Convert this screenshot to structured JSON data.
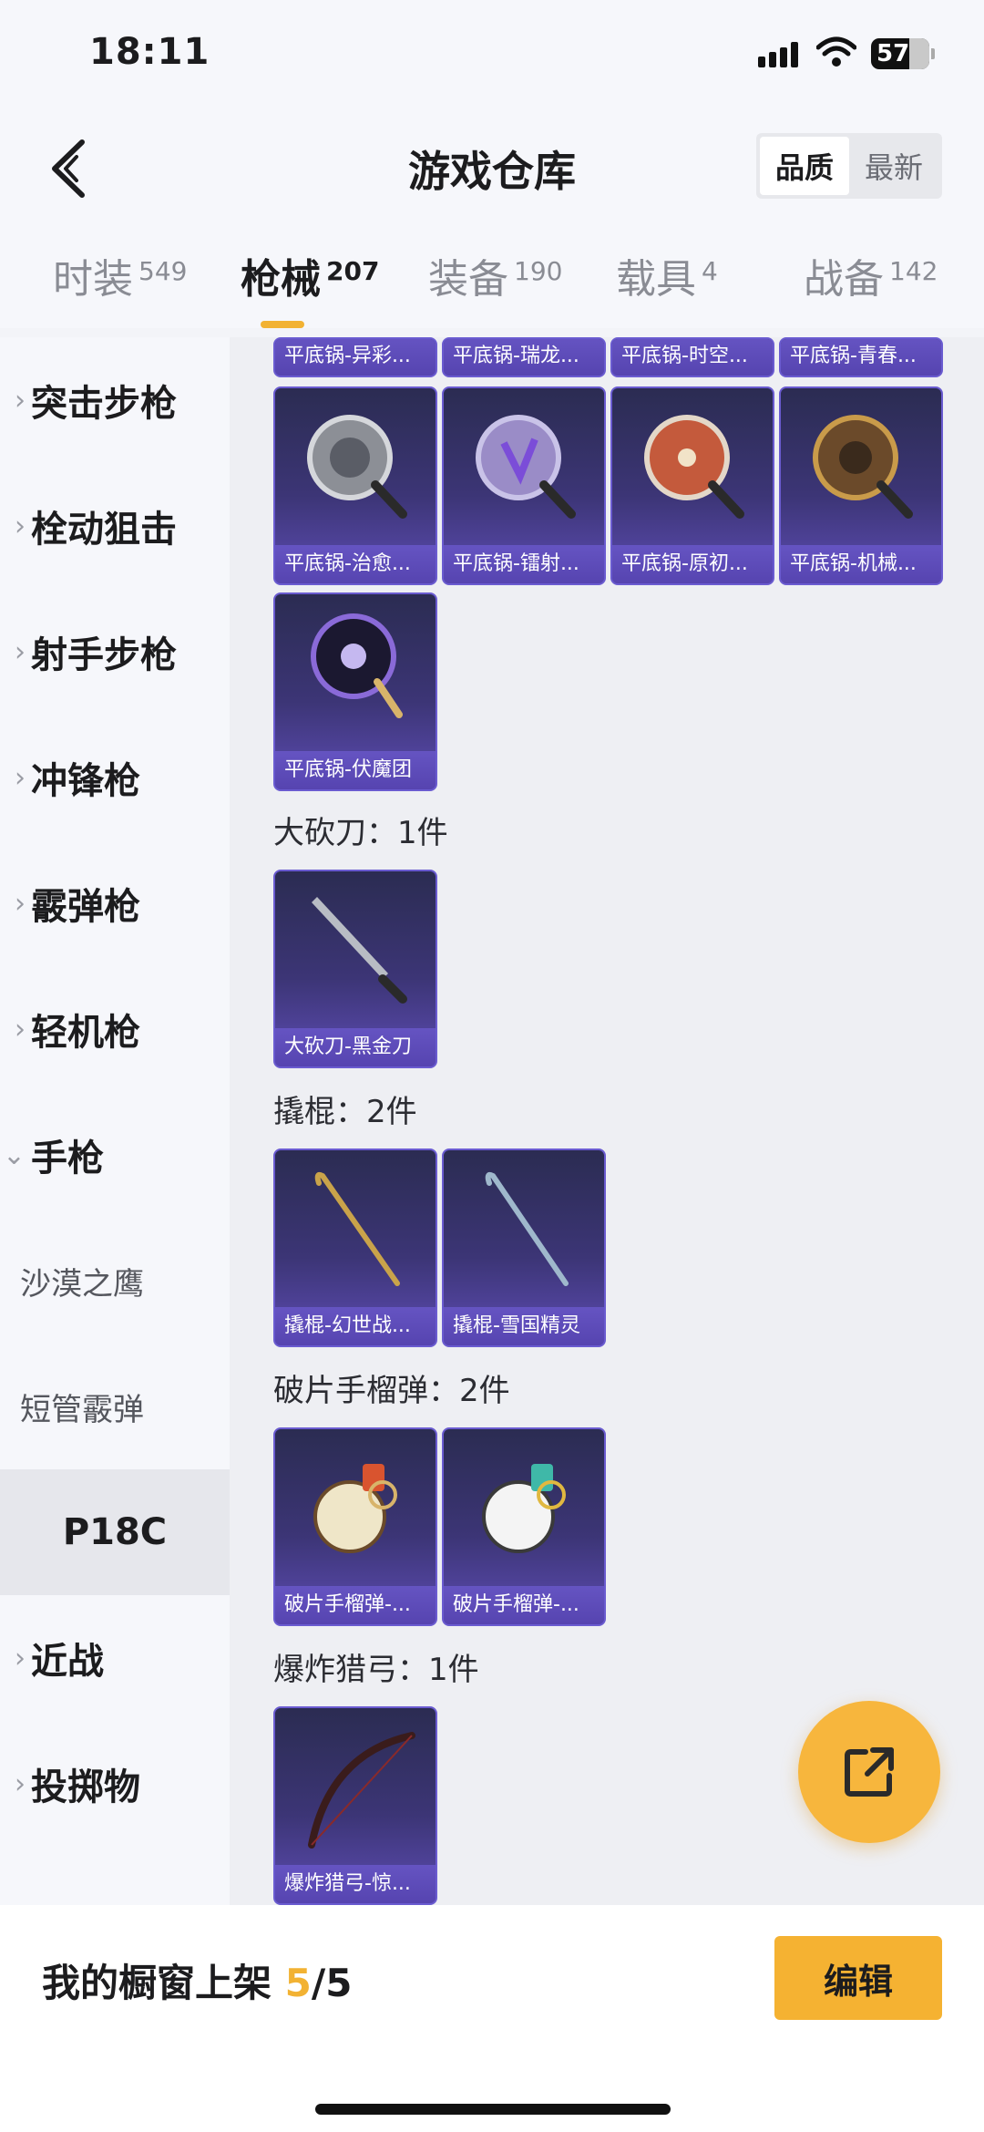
{
  "status": {
    "time": "18:11",
    "battery": "57"
  },
  "header": {
    "title": "游戏仓库",
    "sort": {
      "option1": "品质",
      "option2": "最新"
    }
  },
  "tabs": [
    {
      "label": "时装",
      "count": "549"
    },
    {
      "label": "枪械",
      "count": "207"
    },
    {
      "label": "装备",
      "count": "190"
    },
    {
      "label": "载具",
      "count": "4"
    },
    {
      "label": "战备",
      "count": "142"
    }
  ],
  "sidebar": {
    "items": [
      "突击步枪",
      "栓动狙击",
      "射手步枪",
      "冲锋枪",
      "霰弹枪",
      "轻机枪",
      "手枪",
      "沙漠之鹰",
      "短管霰弹",
      "P18C",
      "近战",
      "投掷物"
    ]
  },
  "content": {
    "top_row": [
      "平底锅-异彩...",
      "平底锅-瑞龙...",
      "平底锅-时空...",
      "平底锅-青春..."
    ],
    "pan_row": [
      "平底锅-治愈...",
      "平底锅-镭射...",
      "平底锅-原初...",
      "平底锅-机械..."
    ],
    "pan_last": "平底锅-伏魔团",
    "machete": {
      "title": "大砍刀：1件",
      "items": [
        "大砍刀-黑金刀"
      ]
    },
    "crowbar": {
      "title": "撬棍：2件",
      "items": [
        "撬棍-幻世战...",
        "撬棍-雪国精灵"
      ]
    },
    "grenade": {
      "title": "破片手榴弹：2件",
      "items": [
        "破片手榴弹-...",
        "破片手榴弹-..."
      ]
    },
    "bow": {
      "title": "爆炸猎弓：1件",
      "items": [
        "爆炸猎弓-惊..."
      ]
    }
  },
  "bottom": {
    "label": "我的橱窗上架",
    "current": "5",
    "total": "/5",
    "edit": "编辑"
  }
}
